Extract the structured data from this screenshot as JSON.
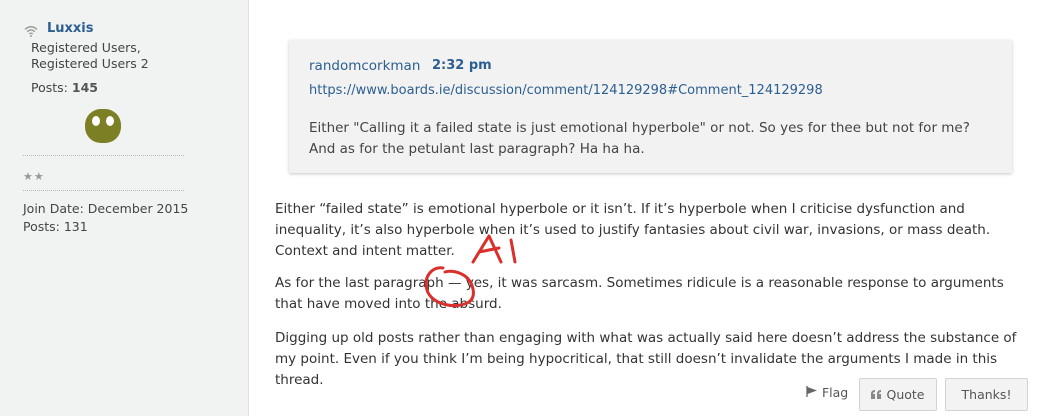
{
  "sidebar": {
    "username": "Luxxis",
    "status_icon": "wifi-icon",
    "roles": [
      "Registered Users,",
      "Registered Users 2"
    ],
    "posts_label": "Posts:",
    "posts_count": "145",
    "avatar_color": "#7d7f24",
    "stars": "★★",
    "join_date": "Join Date: December 2015",
    "posts_line": "Posts: 131"
  },
  "quote": {
    "author": "randomcorkman",
    "time": "2:32 pm",
    "link": "https://www.boards.ie/discussion/comment/124129298#Comment_124129298",
    "text": "Either \"Calling it a failed state is just emotional hyperbole\" or not. So yes for thee but not for me? And as for the petulant last paragraph? Ha ha ha."
  },
  "post": {
    "paragraph_1": "Either “failed state” is emotional hyperbole or it isn’t. If it’s hyperbole when I criticise dysfunction and inequality, it’s also hyperbole when it’s used to justify fantasies about civil war, invasions, or mass death. Context and intent matter.",
    "paragraph_2": "As for the last paragraph — yes, it was sarcasm. Sometimes ridicule is a reasonable response to arguments that have moved into the absurd.",
    "paragraph_3": "Digging up old posts rather than engaging with what was actually said here doesn’t address the substance of my point. Even if you think I’m being hypocritical, that still doesn’t invalidate the arguments I made in this thread."
  },
  "annotation": {
    "text": "AI",
    "color": "#d9302c"
  },
  "actions": {
    "flag": "Flag",
    "quote": "Quote",
    "thanks": "Thanks!"
  },
  "colors": {
    "link": "#2c5f91",
    "sidebar_bg": "#f1f2f2",
    "quote_bg": "#f2f2f2"
  }
}
